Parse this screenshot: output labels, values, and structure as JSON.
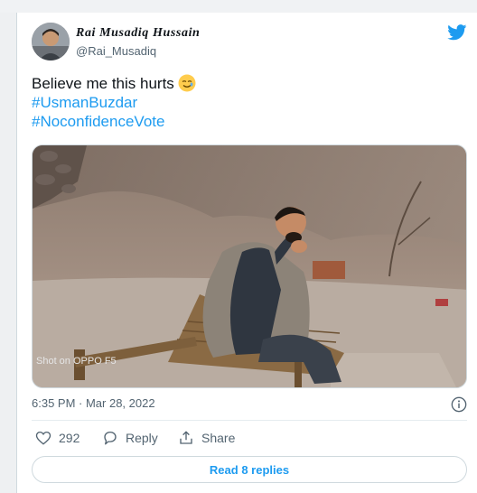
{
  "tweet": {
    "author_name": "Rai Musadiq Hussain",
    "author_handle": "@Rai_Musadiq",
    "text": "Believe me this hurts",
    "emoji": "smiling-face-with-tear-emoji",
    "hashtags": [
      "#UsmanBuzdar",
      "#NoconfidenceVote"
    ],
    "timestamp": "6:35 PM · Mar 28, 2022",
    "likes": "292",
    "reply_label": "Reply",
    "share_label": "Share",
    "read_replies_label": "Read 8 replies",
    "media_watermark": "Shot on OPPO F5"
  },
  "colors": {
    "accent": "#1d9bf0",
    "secondary_text": "#536471",
    "border": "#cfd9de"
  },
  "icons": [
    "twitter-bird-icon",
    "info-icon",
    "heart-icon",
    "reply-icon",
    "share-icon"
  ]
}
